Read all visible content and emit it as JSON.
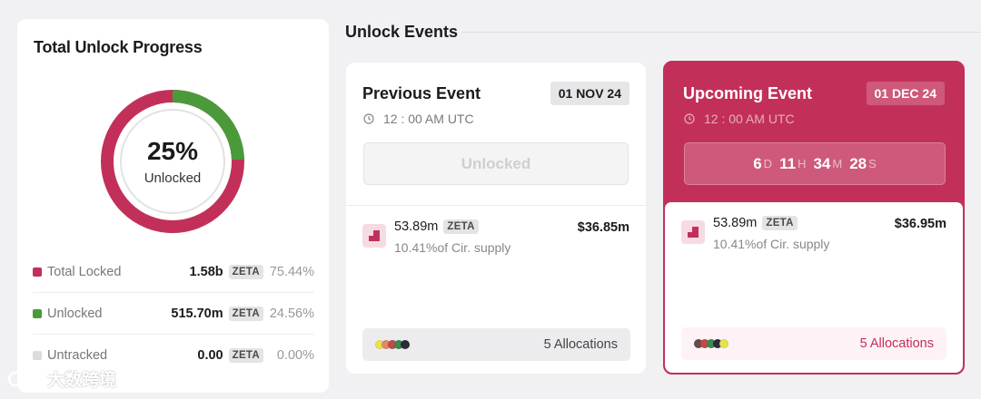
{
  "progress": {
    "title": "Total Unlock Progress",
    "percent_label": "25%",
    "percent_caption": "Unlocked",
    "unlocked_fraction": 0.2456,
    "colors": {
      "locked": "#c2305a",
      "unlocked": "#4a9a3a",
      "untracked": "#dcdcdc"
    },
    "legend": [
      {
        "label": "Total Locked",
        "amount": "1.58b",
        "token": "ZETA",
        "percent": "75.44%",
        "color": "#c2305a"
      },
      {
        "label": "Unlocked",
        "amount": "515.70m",
        "token": "ZETA",
        "percent": "24.56%",
        "color": "#4a9a3a"
      },
      {
        "label": "Untracked",
        "amount": "0.00",
        "token": "ZETA",
        "percent": "0.00%",
        "color": "#dcdcdc"
      }
    ]
  },
  "events": {
    "title": "Unlock Events",
    "previous": {
      "title": "Previous Event",
      "date": "01 NOV 24",
      "time": "12 : 00 AM UTC",
      "status": "Unlocked",
      "amount": "53.89m",
      "token": "ZETA",
      "supply": "10.41%of Cir. supply",
      "usd": "$36.85m",
      "allocations": "5 Allocations",
      "dot_colors": [
        "#e9e24a",
        "#e08a6a",
        "#c24a4a",
        "#3b8a4a",
        "#2b2b3a"
      ]
    },
    "upcoming": {
      "title": "Upcoming Event",
      "date": "01 DEC 24",
      "time": "12 : 00 AM UTC",
      "countdown": {
        "days": "6",
        "d_unit": "D",
        "hours": "11",
        "h_unit": "H",
        "minutes": "34",
        "m_unit": "M",
        "seconds": "28",
        "s_unit": "S"
      },
      "amount": "53.89m",
      "token": "ZETA",
      "supply": "10.41%of Cir. supply",
      "usd": "$36.95m",
      "allocations": "5 Allocations",
      "dot_colors": [
        "#6b4a4a",
        "#c24a4a",
        "#3b8a4a",
        "#2b2b3a",
        "#e9e24a"
      ]
    }
  },
  "watermark": {
    "text": "大数跨境"
  }
}
